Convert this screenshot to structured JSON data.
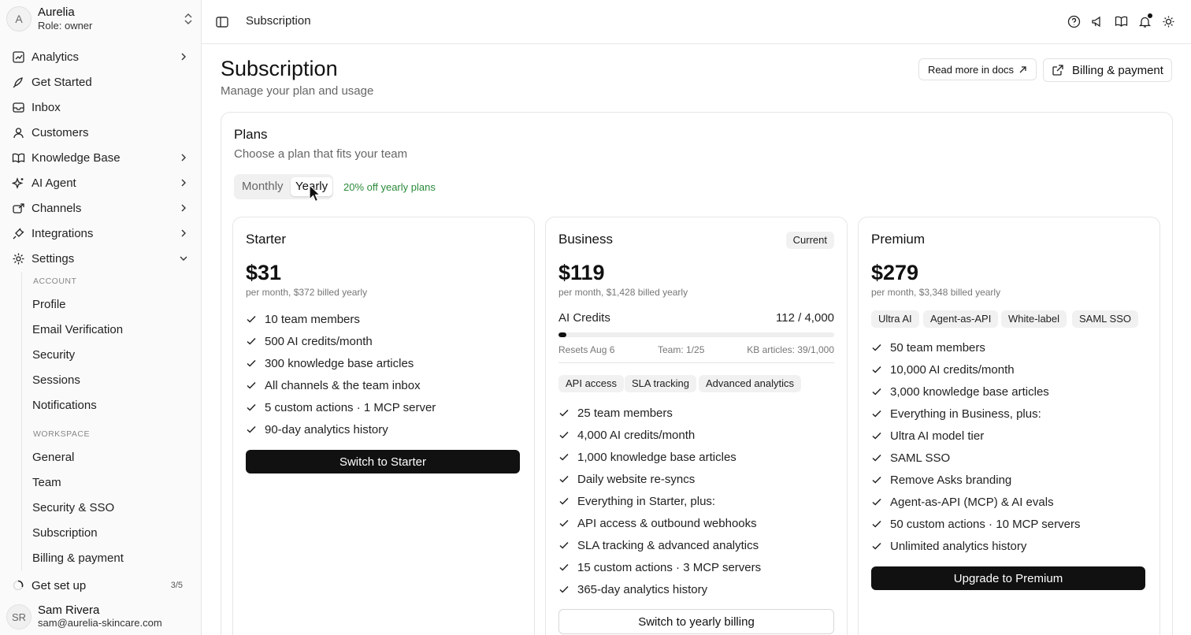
{
  "org": {
    "initial": "A",
    "name": "Aurelia",
    "role": "Role: owner"
  },
  "nav": {
    "analytics": "Analytics",
    "get_started": "Get Started",
    "inbox": "Inbox",
    "customers": "Customers",
    "knowledge_base": "Knowledge Base",
    "ai_agent": "AI Agent",
    "channels": "Channels",
    "integrations": "Integrations",
    "settings": "Settings"
  },
  "settings_menu": {
    "account_label": "ACCOUNT",
    "account_items": [
      "Profile",
      "Email Verification",
      "Security",
      "Sessions",
      "Notifications"
    ],
    "workspace_label": "WORKSPACE",
    "workspace_items": [
      "General",
      "Team",
      "Security & SSO",
      "Subscription",
      "Billing & payment"
    ]
  },
  "setup": {
    "label": "Get set up",
    "count": "3/5"
  },
  "user": {
    "initials": "SR",
    "name": "Sam Rivera",
    "email": "sam@aurelia-skincare.com"
  },
  "topbar": {
    "breadcrumb": "Subscription"
  },
  "page": {
    "title": "Subscription",
    "subtitle": "Manage your plan and usage",
    "docs_button": "Read more in docs",
    "billing_button": "Billing & payment"
  },
  "plans": {
    "title": "Plans",
    "subtitle": "Choose a plan that fits your team",
    "toggle_monthly": "Monthly",
    "toggle_yearly": "Yearly",
    "discount": "20% off yearly plans",
    "starter": {
      "name": "Starter",
      "price": "$31",
      "price_sub": "per month, $372 billed yearly",
      "features": [
        "10 team members",
        "500 AI credits/month",
        "300 knowledge base articles",
        "All channels & the team inbox",
        "5 custom actions · 1 MCP server",
        "90-day analytics history"
      ],
      "cta": "Switch to Starter"
    },
    "business": {
      "name": "Business",
      "badge": "Current",
      "price": "$119",
      "price_sub": "per month, $1,428 billed yearly",
      "credits_label": "AI Credits",
      "credits_value": "112 / 4,000",
      "credits_fraction": 0.028,
      "resets": "Resets Aug 6",
      "team": "Team: 1/25",
      "kb": "KB articles: 39/1,000",
      "chips": [
        "API access",
        "SLA tracking",
        "Advanced analytics"
      ],
      "features": [
        "25 team members",
        "4,000 AI credits/month",
        "1,000 knowledge base articles",
        "Daily website re-syncs",
        "Everything in Starter, plus:",
        "API access & outbound webhooks",
        "SLA tracking & advanced analytics",
        "15 custom actions · 3 MCP servers",
        "365-day analytics history"
      ],
      "cta": "Switch to yearly billing"
    },
    "premium": {
      "name": "Premium",
      "price": "$279",
      "price_sub": "per month, $3,348 billed yearly",
      "chips": [
        "Ultra AI",
        "Agent-as-API",
        "White-label",
        "SAML SSO"
      ],
      "features": [
        "50 team members",
        "10,000 AI credits/month",
        "3,000 knowledge base articles",
        "Everything in Business, plus:",
        "Ultra AI model tier",
        "SAML SSO",
        "Remove Asks branding",
        "Agent-as-API (MCP) & AI evals",
        "50 custom actions · 10 MCP servers",
        "Unlimited analytics history"
      ],
      "cta": "Upgrade to Premium"
    }
  }
}
